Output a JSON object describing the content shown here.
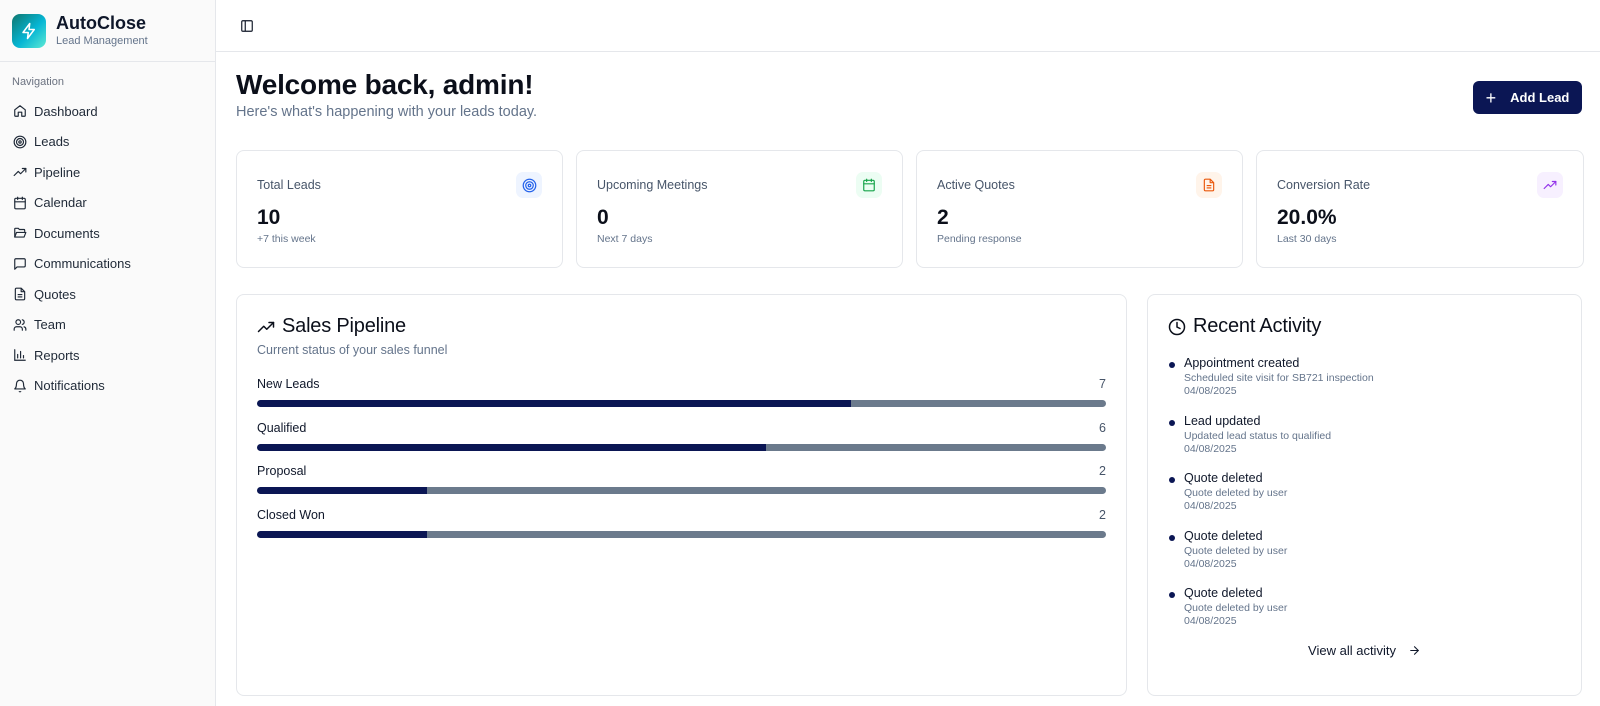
{
  "brand": {
    "name": "AutoClose",
    "subtitle": "Lead Management"
  },
  "sidebar": {
    "section_label": "Navigation",
    "items": [
      {
        "label": "Dashboard",
        "icon": "home-icon"
      },
      {
        "label": "Leads",
        "icon": "target-icon"
      },
      {
        "label": "Pipeline",
        "icon": "trending-up-icon"
      },
      {
        "label": "Calendar",
        "icon": "calendar-icon"
      },
      {
        "label": "Documents",
        "icon": "folder-open-icon"
      },
      {
        "label": "Communications",
        "icon": "message-square-icon"
      },
      {
        "label": "Quotes",
        "icon": "file-text-icon"
      },
      {
        "label": "Team",
        "icon": "users-icon"
      },
      {
        "label": "Reports",
        "icon": "bar-chart-icon"
      },
      {
        "label": "Notifications",
        "icon": "bell-icon"
      }
    ]
  },
  "header": {
    "title": "Welcome back, admin!",
    "subtitle": "Here's what's happening with your leads today.",
    "add_button": "Add Lead"
  },
  "stats": [
    {
      "label": "Total Leads",
      "value": "10",
      "sub": "+7 this week",
      "icon": "target-icon",
      "color": "#2563eb",
      "bg": "#eef4ff"
    },
    {
      "label": "Upcoming Meetings",
      "value": "0",
      "sub": "Next 7 days",
      "icon": "calendar-icon",
      "color": "#16a34a",
      "bg": "#ecfdf3"
    },
    {
      "label": "Active Quotes",
      "value": "2",
      "sub": "Pending response",
      "icon": "file-text-icon",
      "color": "#ea580c",
      "bg": "#fff4ea"
    },
    {
      "label": "Conversion Rate",
      "value": "20.0%",
      "sub": "Last 30 days",
      "icon": "trending-up-icon",
      "color": "#9333ea",
      "bg": "#f7f0ff"
    }
  ],
  "pipeline": {
    "title": "Sales Pipeline",
    "description": "Current status of your sales funnel",
    "total": 10,
    "stages": [
      {
        "label": "New Leads",
        "count": 7
      },
      {
        "label": "Qualified",
        "count": 6
      },
      {
        "label": "Proposal",
        "count": 2
      },
      {
        "label": "Closed Won",
        "count": 2
      }
    ]
  },
  "activity": {
    "title": "Recent Activity",
    "items": [
      {
        "title": "Appointment created",
        "desc": "Scheduled site visit for SB721 inspection",
        "date": "04/08/2025"
      },
      {
        "title": "Lead updated",
        "desc": "Updated lead status to qualified",
        "date": "04/08/2025"
      },
      {
        "title": "Quote deleted",
        "desc": "Quote deleted by user",
        "date": "04/08/2025"
      },
      {
        "title": "Quote deleted",
        "desc": "Quote deleted by user",
        "date": "04/08/2025"
      },
      {
        "title": "Quote deleted",
        "desc": "Quote deleted by user",
        "date": "04/08/2025"
      }
    ],
    "view_all": "View all activity"
  },
  "colors": {
    "primary": "#0b1654",
    "bar_track": "#6b7a8c",
    "border": "#e5e7eb"
  }
}
